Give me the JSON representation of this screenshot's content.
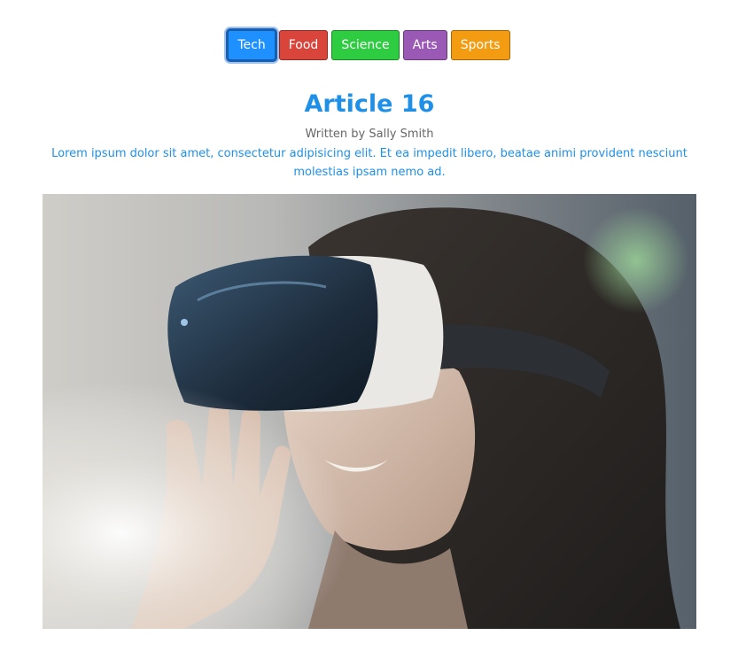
{
  "categories": [
    {
      "label": "Tech",
      "color": "#1e90ff",
      "active": true
    },
    {
      "label": "Food",
      "color": "#d9443b",
      "active": false
    },
    {
      "label": "Science",
      "color": "#2ecc40",
      "active": false
    },
    {
      "label": "Arts",
      "color": "#9b59b6",
      "active": false
    },
    {
      "label": "Sports",
      "color": "#f39c12",
      "active": false
    }
  ],
  "article": {
    "title": "Article 16",
    "author": "Written by Sally Smith",
    "excerpt": "Lorem ipsum dolor sit amet, consectetur adipisicing elit. Et ea impedit libero, beatae animi provident nesciunt molestias ipsam nemo ad."
  },
  "colors": {
    "accent": "#1e90e8",
    "muted_text": "#666666"
  }
}
